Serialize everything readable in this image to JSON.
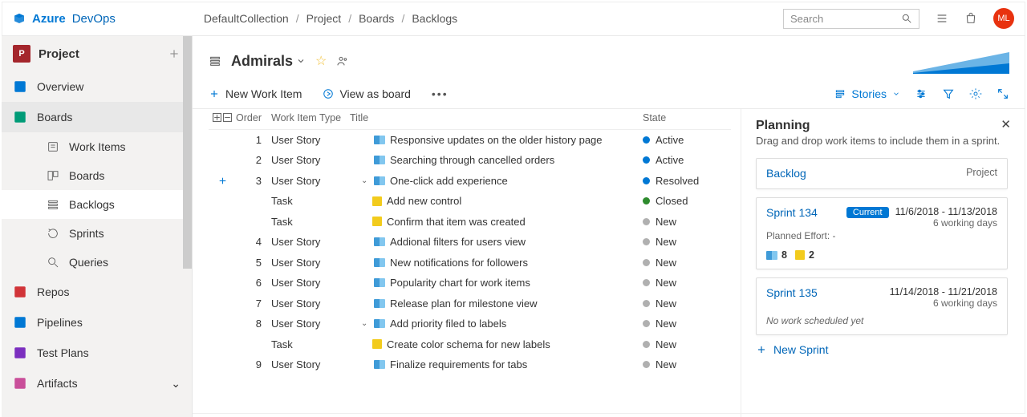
{
  "brand": {
    "azure": "Azure",
    "devops": "DevOps"
  },
  "breadcrumb": [
    "DefaultCollection",
    "Project",
    "Boards",
    "Backlogs"
  ],
  "search": {
    "placeholder": "Search"
  },
  "avatar_initials": "ML",
  "project_header": "Project",
  "nav": {
    "groups": [
      {
        "id": "overview",
        "label": "Overview",
        "color": "#0078d4"
      },
      {
        "id": "boards",
        "label": "Boards",
        "color": "#009b77",
        "expanded": true,
        "active": true,
        "children": [
          {
            "id": "workitems",
            "label": "Work Items"
          },
          {
            "id": "boards2",
            "label": "Boards"
          },
          {
            "id": "backlogs",
            "label": "Backlogs",
            "selected": true
          },
          {
            "id": "sprints",
            "label": "Sprints"
          },
          {
            "id": "queries",
            "label": "Queries"
          }
        ]
      },
      {
        "id": "repos",
        "label": "Repos",
        "color": "#d13438"
      },
      {
        "id": "pipelines",
        "label": "Pipelines",
        "color": "#0078d4"
      },
      {
        "id": "testplans",
        "label": "Test Plans",
        "color": "#7b2fbf"
      },
      {
        "id": "artifacts",
        "label": "Artifacts",
        "color": "#c94f9a"
      }
    ]
  },
  "team": "Admirals",
  "toolbar": {
    "new_item": "New Work Item",
    "view_board": "View as board",
    "level": "Stories"
  },
  "columns": {
    "order": "Order",
    "type": "Work Item Type",
    "title": "Title",
    "state": "State"
  },
  "rows": [
    {
      "order": "1",
      "type": "User Story",
      "icon": "story",
      "indent": 1,
      "title": "Responsive updates on the older history page",
      "state": "Active",
      "dot": "#0078d4"
    },
    {
      "order": "2",
      "type": "User Story",
      "icon": "story",
      "indent": 1,
      "title": "Searching through cancelled orders",
      "state": "Active",
      "dot": "#0078d4"
    },
    {
      "order": "3",
      "type": "User Story",
      "icon": "story",
      "indent": 1,
      "title": "One-click add experience",
      "expand": true,
      "addBtn": true,
      "state": "Resolved",
      "dot": "#0078d4"
    },
    {
      "order": "",
      "type": "Task",
      "icon": "task",
      "indent": 2,
      "title": "Add new control",
      "state": "Closed",
      "dot": "#2e8b2e"
    },
    {
      "order": "",
      "type": "Task",
      "icon": "task",
      "indent": 2,
      "title": "Confirm that item was created",
      "state": "New",
      "dot": "#b0b0b0"
    },
    {
      "order": "4",
      "type": "User Story",
      "icon": "story",
      "indent": 1,
      "title": "Addional filters for users view",
      "state": "New",
      "dot": "#b0b0b0"
    },
    {
      "order": "5",
      "type": "User Story",
      "icon": "story",
      "indent": 1,
      "title": "New notifications for followers",
      "state": "New",
      "dot": "#b0b0b0"
    },
    {
      "order": "6",
      "type": "User Story",
      "icon": "story",
      "indent": 1,
      "title": "Popularity chart for work items",
      "state": "New",
      "dot": "#b0b0b0"
    },
    {
      "order": "7",
      "type": "User Story",
      "icon": "story",
      "indent": 1,
      "title": "Release plan for milestone view",
      "state": "New",
      "dot": "#b0b0b0"
    },
    {
      "order": "8",
      "type": "User Story",
      "icon": "story",
      "indent": 1,
      "title": "Add priority filed to labels",
      "expand": true,
      "state": "New",
      "dot": "#b0b0b0"
    },
    {
      "order": "",
      "type": "Task",
      "icon": "task",
      "indent": 2,
      "title": "Create color schema for new labels",
      "state": "New",
      "dot": "#b0b0b0"
    },
    {
      "order": "9",
      "type": "User Story",
      "icon": "story",
      "indent": 1,
      "title": "Finalize requirements for tabs",
      "state": "New",
      "dot": "#b0b0b0"
    }
  ],
  "panel": {
    "title": "Planning",
    "desc": "Drag and drop work items to include them in a sprint.",
    "backlog": {
      "title": "Backlog",
      "scope": "Project"
    },
    "sprints": [
      {
        "name": "Sprint 134",
        "current": true,
        "current_label": "Current",
        "dates": "11/6/2018 - 11/13/2018",
        "days": "6 working days",
        "effort_label": "Planned Effort: -",
        "counts": [
          {
            "icon": "story",
            "n": "8"
          },
          {
            "icon": "task",
            "n": "2"
          }
        ]
      },
      {
        "name": "Sprint 135",
        "dates": "11/14/2018 - 11/21/2018",
        "days": "6 working days",
        "empty": "No work scheduled yet"
      }
    ],
    "add": "New Sprint"
  }
}
